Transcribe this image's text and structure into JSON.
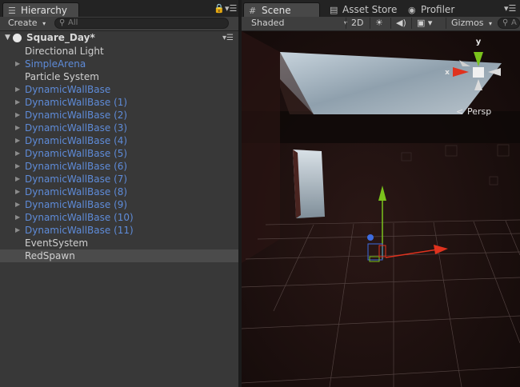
{
  "hierarchy": {
    "tab_label": "Hierarchy",
    "create_label": "Create",
    "search_placeholder": "All",
    "scene_name": "Square_Day*",
    "items": [
      {
        "label": "Directional Light",
        "kind": "plain",
        "expandable": false
      },
      {
        "label": "SimpleArena",
        "kind": "prefab",
        "expandable": true
      },
      {
        "label": "Particle System",
        "kind": "plain",
        "expandable": false
      },
      {
        "label": "DynamicWallBase",
        "kind": "prefab",
        "expandable": true
      },
      {
        "label": "DynamicWallBase (1)",
        "kind": "prefab",
        "expandable": true
      },
      {
        "label": "DynamicWallBase (2)",
        "kind": "prefab",
        "expandable": true
      },
      {
        "label": "DynamicWallBase (3)",
        "kind": "prefab",
        "expandable": true
      },
      {
        "label": "DynamicWallBase (4)",
        "kind": "prefab",
        "expandable": true
      },
      {
        "label": "DynamicWallBase (5)",
        "kind": "prefab",
        "expandable": true
      },
      {
        "label": "DynamicWallBase (6)",
        "kind": "prefab",
        "expandable": true
      },
      {
        "label": "DynamicWallBase (7)",
        "kind": "prefab",
        "expandable": true
      },
      {
        "label": "DynamicWallBase (8)",
        "kind": "prefab",
        "expandable": true
      },
      {
        "label": "DynamicWallBase (9)",
        "kind": "prefab",
        "expandable": true
      },
      {
        "label": "DynamicWallBase (10)",
        "kind": "prefab",
        "expandable": true
      },
      {
        "label": "DynamicWallBase (11)",
        "kind": "prefab",
        "expandable": true
      },
      {
        "label": "EventSystem",
        "kind": "plain",
        "expandable": false
      },
      {
        "label": "RedSpawn",
        "kind": "plain",
        "expandable": false,
        "selected": true
      }
    ]
  },
  "scene_view": {
    "tabs": [
      {
        "label": "Scene",
        "active": true
      },
      {
        "label": "Asset Store",
        "active": false
      },
      {
        "label": "Profiler",
        "active": false
      }
    ],
    "shading_mode": "Shaded",
    "mode_2d_label": "2D",
    "gizmos_label": "Gizmos",
    "search_placeholder": "A",
    "gizmo": {
      "x_label": "x",
      "y_label": "y",
      "projection_label": "Persp"
    }
  },
  "colors": {
    "prefab_text": "#5e8bd8",
    "panel_bg": "#383838",
    "selected_row": "#4b4b4b",
    "axis_x": "#e0321e",
    "axis_y": "#7ac21c",
    "axis_z": "#3d6ce0"
  }
}
